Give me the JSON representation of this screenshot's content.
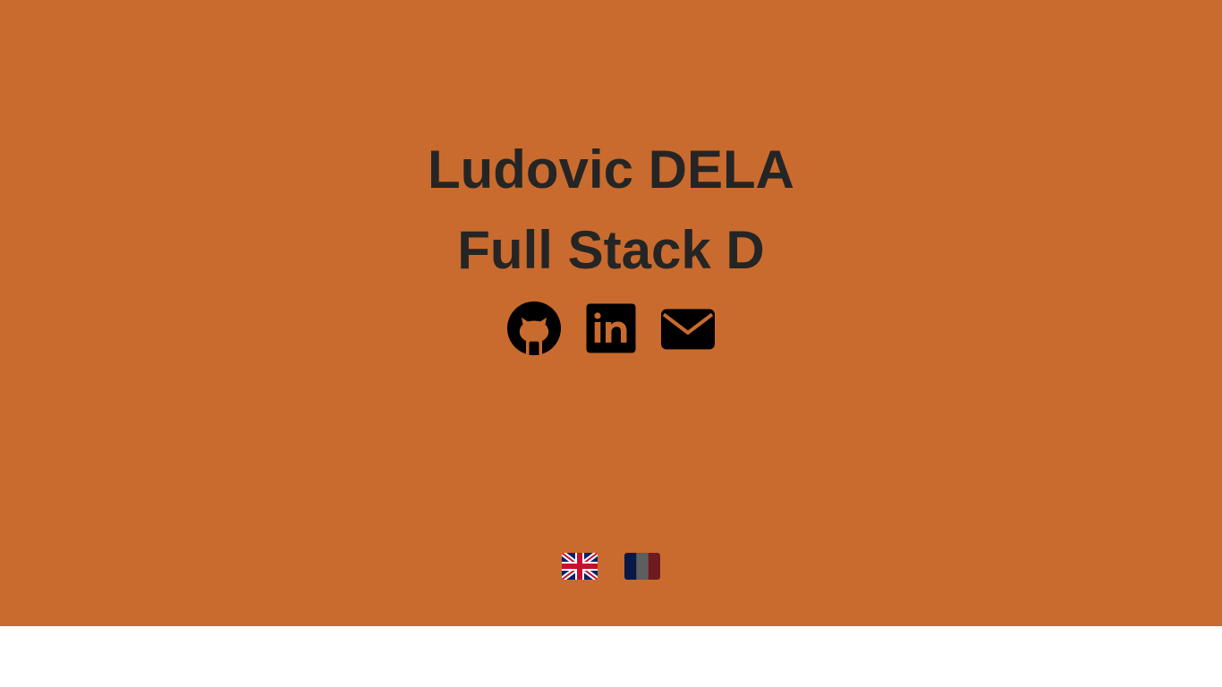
{
  "hero": {
    "name": "Ludovic DELA",
    "role": "Full Stack D",
    "background_color": "#c96b2e"
  },
  "social_links": [
    {
      "icon": "github-icon",
      "label": "GitHub"
    },
    {
      "icon": "linkedin-icon",
      "label": "LinkedIn"
    },
    {
      "icon": "envelope-icon",
      "label": "Email"
    }
  ],
  "languages": [
    {
      "icon": "uk-flag-icon",
      "code": "en"
    },
    {
      "icon": "france-flag-icon",
      "code": "fr"
    }
  ]
}
